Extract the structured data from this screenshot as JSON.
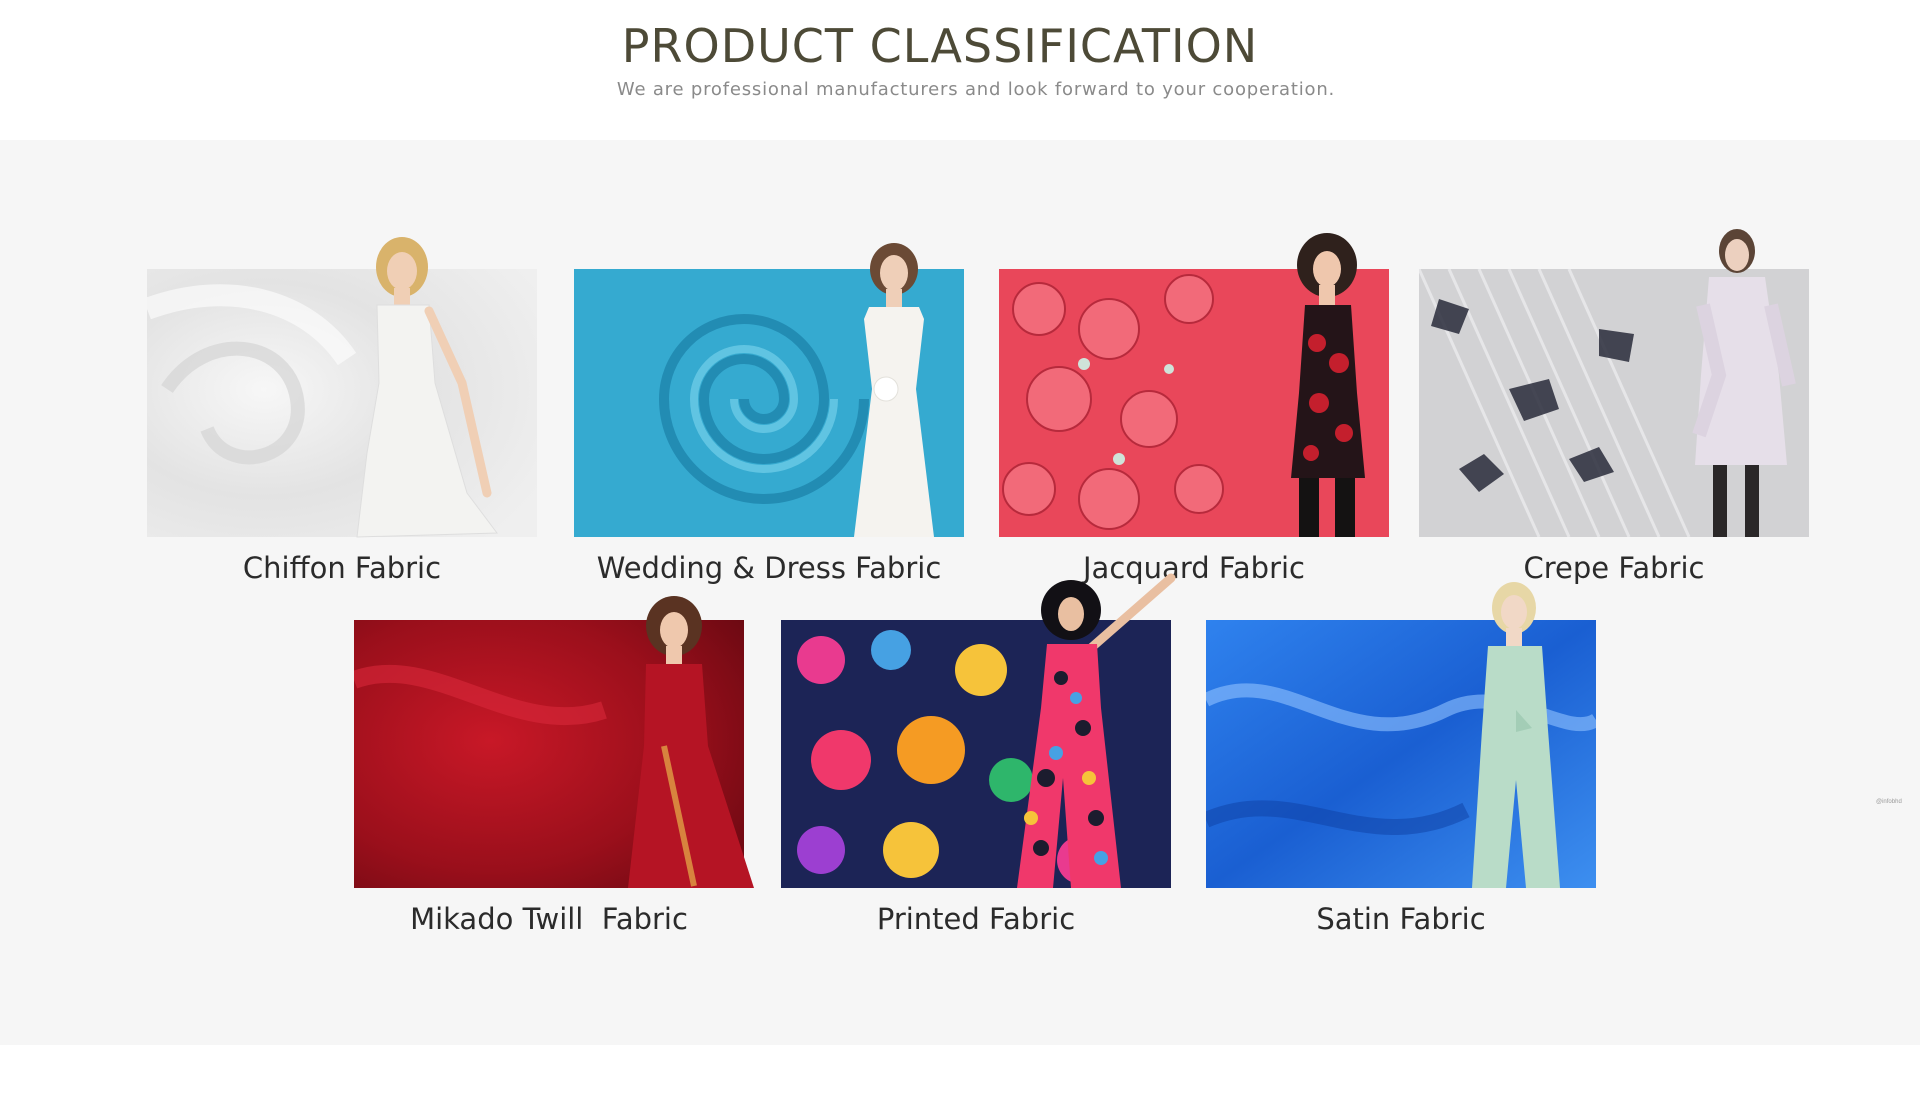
{
  "header": {
    "title": "PRODUCT CLASSIFICATION",
    "subtitle": "We are professional manufacturers and look forward to your cooperation."
  },
  "categories": [
    {
      "label": "Chiffon Fabric",
      "image": "white-chiffon-gown-photo",
      "fabric_color": "#e9e9e9",
      "dress_color": "#f2f2f0"
    },
    {
      "label": "Wedding & Dress Fabric",
      "image": "turquoise-satin-wedding-dress-photo",
      "fabric_color": "#33a9cf",
      "dress_color": "#f4f1ec"
    },
    {
      "label": "Jacquard Fabric",
      "image": "red-jacquard-lace-dress-photo",
      "fabric_color": "#e8475a",
      "dress_color": "#9e1b25"
    },
    {
      "label": "Crepe Fabric",
      "image": "printed-crepe-ruffle-dress-photo",
      "fabric_color": "#c9c9cc",
      "dress_color": "#e4dde8"
    },
    {
      "label": "Mikado Twill  Fabric",
      "image": "red-sequin-gown-photo",
      "fabric_color": "#a5101c",
      "dress_color": "#b11422"
    },
    {
      "label": "Printed Fabric",
      "image": "colorful-printed-jumpsuit-photo",
      "fabric_color": "#1c2456",
      "dress_color": "#f0386b"
    },
    {
      "label": "Satin Fabric",
      "image": "blue-satin-mint-jumpsuit-photo",
      "fabric_color": "#1f6de0",
      "dress_color": "#b9dcc8"
    }
  ],
  "edge_tag": "@infobhd"
}
